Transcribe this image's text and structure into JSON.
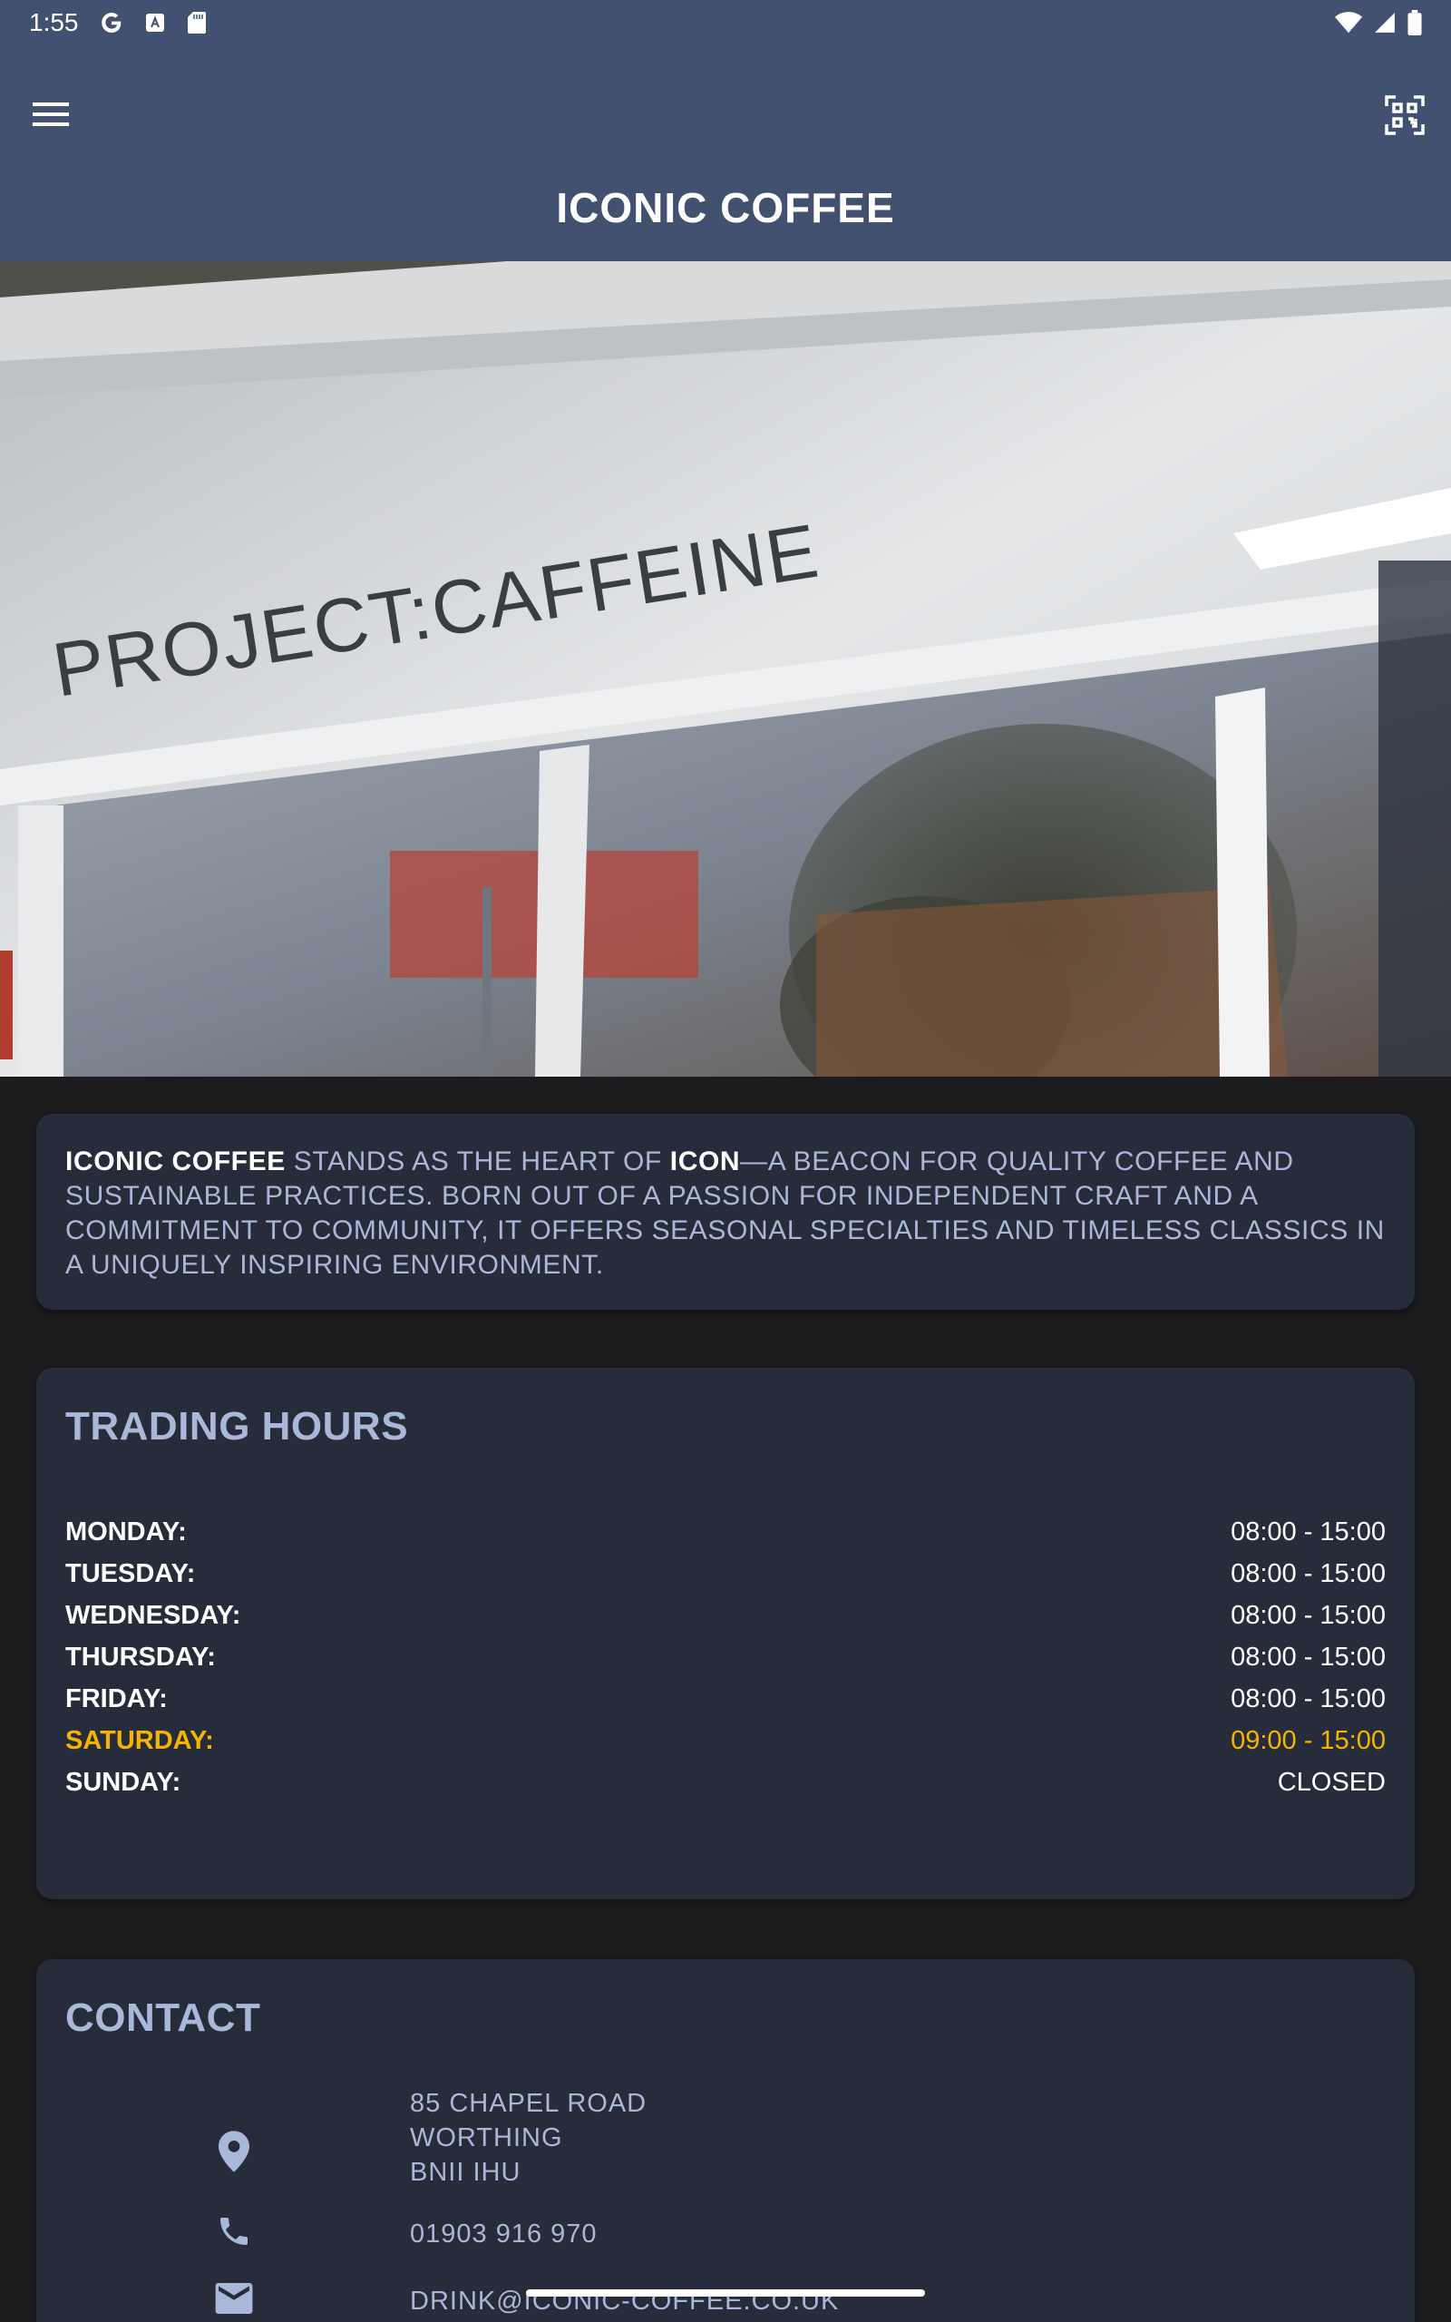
{
  "status_bar": {
    "time": "1:55",
    "left_icons": [
      "google-icon",
      "translate-icon",
      "sd-card-icon"
    ],
    "right_icons": [
      "wifi-icon",
      "signal-icon",
      "battery-icon"
    ]
  },
  "app_bar": {
    "title": "ICONIC COFFEE",
    "menu_icon": "menu-icon",
    "qr_icon": "qr-scan-icon"
  },
  "hero": {
    "sign_text": "PROJECT:CAFFEINE"
  },
  "about": {
    "brand": "ICONIC COFFEE",
    "text_1": " STANDS AS THE HEART OF ",
    "highlight": "ICON",
    "text_2": "—A BEACON FOR QUALITY COFFEE AND SUSTAINABLE PRACTICES. BORN OUT OF A PASSION FOR INDEPENDENT CRAFT AND A COMMITMENT TO COMMUNITY, IT OFFERS SEASONAL SPECIALTIES AND TIMELESS CLASSICS IN A UNIQUELY INSPIRING ENVIRONMENT."
  },
  "hours": {
    "heading": "TRADING HOURS",
    "days": [
      {
        "day": "MONDAY:",
        "time": "08:00 - 15:00"
      },
      {
        "day": "TUESDAY:",
        "time": "08:00 - 15:00"
      },
      {
        "day": "WEDNESDAY:",
        "time": "08:00 - 15:00"
      },
      {
        "day": "THURSDAY:",
        "time": "08:00 - 15:00"
      },
      {
        "day": "FRIDAY:",
        "time": "08:00 - 15:00"
      },
      {
        "day": "SATURDAY:",
        "time": "09:00 - 15:00"
      },
      {
        "day": "SUNDAY:",
        "time": "CLOSED"
      }
    ],
    "today_color": "#f6b400"
  },
  "contact": {
    "heading": "CONTACT",
    "address_lines": [
      "85 CHAPEL ROAD",
      "WORTHING",
      "BNII IHU"
    ],
    "phone": "01903 916 970",
    "email": "DRINK@ICONIC-COFFEE.CO.UK",
    "icons": [
      "location-pin-icon",
      "phone-icon",
      "email-icon"
    ]
  },
  "colors": {
    "app_bar": "#425170",
    "card": "#262c3a",
    "background": "#1c1c1e",
    "accent_text": "#a9b7d9",
    "highlight": "#f6b400"
  }
}
